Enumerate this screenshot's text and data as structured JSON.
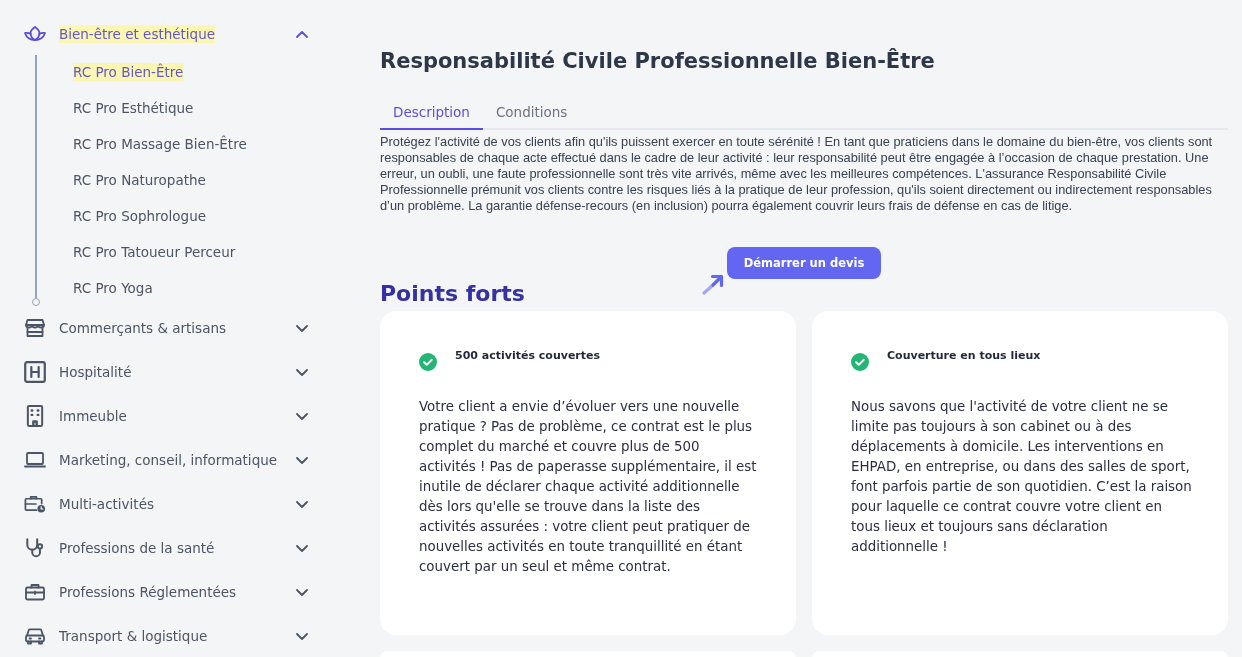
{
  "sidebar": {
    "groups": [
      {
        "label": "Bien-être et esthétique",
        "expanded": true,
        "selected": true,
        "children": [
          {
            "label": "RC Pro Bien-Être",
            "selected": true
          },
          {
            "label": "RC Pro Esthétique",
            "selected": false
          },
          {
            "label": "RC Pro Massage Bien-Être",
            "selected": false
          },
          {
            "label": "RC Pro Naturopathe",
            "selected": false
          },
          {
            "label": "RC Pro Sophrologue",
            "selected": false
          },
          {
            "label": "RC Pro Tatoueur Perceur",
            "selected": false
          },
          {
            "label": "RC Pro Yoga",
            "selected": false
          }
        ]
      },
      {
        "label": "Commerçants & artisans",
        "expanded": false,
        "selected": false
      },
      {
        "label": "Hospitalité",
        "expanded": false,
        "selected": false
      },
      {
        "label": "Immeuble",
        "expanded": false,
        "selected": false
      },
      {
        "label": "Marketing, conseil, informatique",
        "expanded": false,
        "selected": false
      },
      {
        "label": "Multi-activités",
        "expanded": false,
        "selected": false
      },
      {
        "label": "Professions de la santé",
        "expanded": false,
        "selected": false
      },
      {
        "label": "Professions Réglementées",
        "expanded": false,
        "selected": false
      },
      {
        "label": "Transport & logistique",
        "expanded": false,
        "selected": false
      }
    ]
  },
  "page": {
    "title": "Responsabilité Civile Professionnelle Bien-Être",
    "tabs": [
      {
        "label": "Description",
        "selected": true
      },
      {
        "label": "Conditions",
        "selected": false
      }
    ],
    "description": "Protégez l'activité de vos clients afin qu'ils puissent exercer en toute sérénité ! En tant que praticiens dans le domaine du bien-être, vos clients sont responsables de chaque acte effectué dans le cadre de leur activité : leur responsabilité peut être engagée à l’occasion de chaque prestation. Une erreur, un oubli, une faute professionnelle sont très vite arrivés, même avec les meilleures compétences. L'assurance Responsabilité Civile Professionnelle prémunit vos clients contre les risques liés à la pratique de leur profession, qu'ils soient directement ou indirectement responsables d’un problème. La garantie défense-recours (en inclusion) pourra également couvrir leurs frais de défense en cas de litige.",
    "cta_button": "Démarrer un devis",
    "highlights_title": "Points forts",
    "highlights": [
      {
        "kind": "feature",
        "title": "500 activités couvertes",
        "text": "Votre client a envie d’évoluer vers une nouvelle pratique ? Pas de problème, ce contrat est le plus complet du marché et couvre plus de 500 activités ! Pas de paperasse supplémentaire, il est inutile de déclarer chaque activité additionnelle dès lors qu'elle se trouve dans la liste des activités assurées : votre client peut pratiquer de nouvelles activités en toute tranquillité en étant couvert par un seul et même contrat."
      },
      {
        "kind": "feature",
        "title": "Couverture en tous lieux",
        "text": "Nous savons que l'activité de votre client ne se limite pas toujours à son cabinet ou à des déplacements à domicile. Les interventions en EHPAD, en entreprise, ou dans des salles de sport, font parfois partie de son quotidien. C’est la raison pour laquelle ce contrat couvre votre client en tous lieux et toujours sans déclaration additionnelle !"
      },
      {
        "kind": "cut_off"
      },
      {
        "kind": "cut_off"
      }
    ]
  }
}
